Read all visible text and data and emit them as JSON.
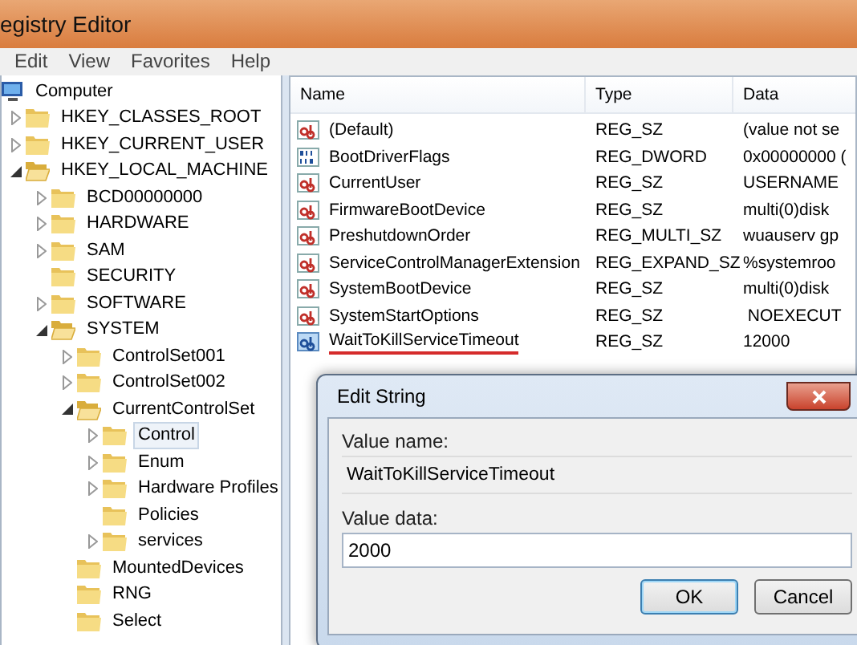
{
  "window": {
    "title": "egistry Editor"
  },
  "menu": [
    "Edit",
    "View",
    "Favorites",
    "Help"
  ],
  "tree": [
    {
      "label": "Computer",
      "kind": "computer",
      "selected": false,
      "children": [
        {
          "label": "HKEY_CLASSES_ROOT",
          "kind": "folder",
          "expanded": false,
          "selected": false
        },
        {
          "label": "HKEY_CURRENT_USER",
          "kind": "folder",
          "expanded": false,
          "selected": false
        },
        {
          "label": "HKEY_LOCAL_MACHINE",
          "kind": "folder",
          "expanded": true,
          "selected": false,
          "children": [
            {
              "label": "BCD00000000",
              "kind": "folder",
              "expanded": false,
              "selected": false
            },
            {
              "label": "HARDWARE",
              "kind": "folder",
              "expanded": false,
              "selected": false
            },
            {
              "label": "SAM",
              "kind": "folder",
              "expanded": false,
              "selected": false
            },
            {
              "label": "SECURITY",
              "kind": "leaf",
              "selected": false
            },
            {
              "label": "SOFTWARE",
              "kind": "folder",
              "expanded": false,
              "selected": false
            },
            {
              "label": "SYSTEM",
              "kind": "folder",
              "expanded": true,
              "selected": false,
              "children": [
                {
                  "label": "ControlSet001",
                  "kind": "folder",
                  "expanded": false,
                  "selected": false
                },
                {
                  "label": "ControlSet002",
                  "kind": "folder",
                  "expanded": false,
                  "selected": false
                },
                {
                  "label": "CurrentControlSet",
                  "kind": "folder",
                  "expanded": true,
                  "selected": false,
                  "children": [
                    {
                      "label": "Control",
                      "kind": "folder",
                      "expanded": false,
                      "selected": true
                    },
                    {
                      "label": "Enum",
                      "kind": "folder",
                      "expanded": false,
                      "selected": false
                    },
                    {
                      "label": "Hardware Profiles",
                      "kind": "folder",
                      "expanded": false,
                      "selected": false
                    },
                    {
                      "label": "Policies",
                      "kind": "leaf",
                      "selected": false
                    },
                    {
                      "label": "services",
                      "kind": "folder",
                      "expanded": false,
                      "selected": false
                    }
                  ]
                },
                {
                  "label": "MountedDevices",
                  "kind": "leaf",
                  "selected": false
                },
                {
                  "label": "RNG",
                  "kind": "leaf",
                  "selected": false
                },
                {
                  "label": "Select",
                  "kind": "leaf",
                  "selected": false
                }
              ]
            }
          ]
        }
      ]
    }
  ],
  "values": {
    "columns": [
      "Name",
      "Type",
      "Data"
    ],
    "rows": [
      {
        "name": "(Default)",
        "type": "REG_SZ",
        "data": "(value not se",
        "kind": "string",
        "selected": false,
        "underlined": false
      },
      {
        "name": "BootDriverFlags",
        "type": "REG_DWORD",
        "data": "0x00000000 (",
        "kind": "binary",
        "selected": false,
        "underlined": false
      },
      {
        "name": "CurrentUser",
        "type": "REG_SZ",
        "data": "USERNAME",
        "kind": "string",
        "selected": false,
        "underlined": false
      },
      {
        "name": "FirmwareBootDevice",
        "type": "REG_SZ",
        "data": "multi(0)disk",
        "kind": "string",
        "selected": false,
        "underlined": false
      },
      {
        "name": "PreshutdownOrder",
        "type": "REG_MULTI_SZ",
        "data": "wuauserv gp",
        "kind": "string",
        "selected": false,
        "underlined": false
      },
      {
        "name": "ServiceControlManagerExtension",
        "type": "REG_EXPAND_SZ",
        "data": "%systemroo",
        "kind": "string",
        "selected": false,
        "underlined": false
      },
      {
        "name": "SystemBootDevice",
        "type": "REG_SZ",
        "data": "multi(0)disk",
        "kind": "string",
        "selected": false,
        "underlined": false
      },
      {
        "name": "SystemStartOptions",
        "type": "REG_SZ",
        "data": " NOEXECUT",
        "kind": "string",
        "selected": false,
        "underlined": false
      },
      {
        "name": "WaitToKillServiceTimeout",
        "type": "REG_SZ",
        "data": "12000",
        "kind": "string",
        "selected": true,
        "underlined": true
      }
    ]
  },
  "dialog": {
    "title": "Edit String",
    "name_label": "Value name:",
    "name_value": "WaitToKillServiceTimeout",
    "data_label": "Value data:",
    "data_value": "2000",
    "buttons": [
      {
        "label": "OK",
        "default": true
      },
      {
        "label": "Cancel",
        "default": false
      }
    ]
  }
}
